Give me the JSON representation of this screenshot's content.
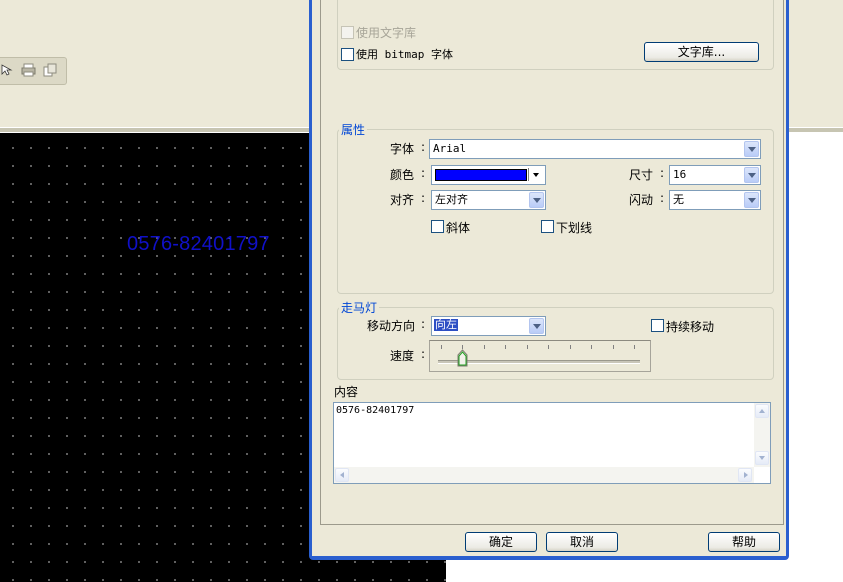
{
  "canvas": {
    "text": "0576-82401797",
    "text_color": "#1010c8"
  },
  "toolbar_icons": [
    "cursor-icon",
    "printer-icon",
    "copy-icon"
  ],
  "font_library": {
    "use_library_label": "使用文字库",
    "use_bitmap_label": "使用 bitmap 字体",
    "library_button": "文字库..."
  },
  "properties": {
    "title": "属性",
    "font_label": "字体",
    "font_value": "Arial",
    "color_label": "颜色",
    "color_value": "#0000ff",
    "size_label": "尺寸",
    "size_value": "16",
    "align_label": "对齐",
    "align_value": "左对齐",
    "blink_label": "闪动",
    "blink_value": "无",
    "italic_label": "斜体",
    "underline_label": "下划线",
    "colon": ":"
  },
  "marquee": {
    "title": "走马灯",
    "direction_label": "移动方向",
    "direction_value": "向左",
    "continuous_label": "持续移动",
    "speed_label": "速度",
    "speed_value": 0.12
  },
  "content": {
    "title": "内容",
    "value": "0576-82401797"
  },
  "buttons": {
    "ok": "确定",
    "cancel": "取消",
    "help": "帮助"
  }
}
